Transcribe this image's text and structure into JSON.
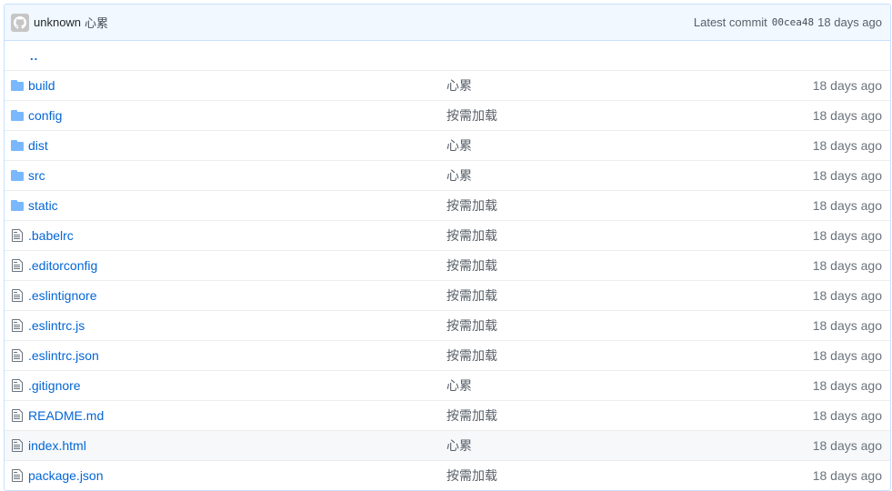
{
  "commit": {
    "author": "unknown",
    "message": "心累",
    "latest_label": "Latest commit",
    "sha": "00cea48",
    "age": "18 days ago"
  },
  "parent_dir": "..",
  "files": [
    {
      "type": "directory",
      "name": "build",
      "message": "心累",
      "age": "18 days ago"
    },
    {
      "type": "directory",
      "name": "config",
      "message": "按需加载",
      "age": "18 days ago"
    },
    {
      "type": "directory",
      "name": "dist",
      "message": "心累",
      "age": "18 days ago"
    },
    {
      "type": "directory",
      "name": "src",
      "message": "心累",
      "age": "18 days ago"
    },
    {
      "type": "directory",
      "name": "static",
      "message": "按需加载",
      "age": "18 days ago"
    },
    {
      "type": "file",
      "name": ".babelrc",
      "message": "按需加载",
      "age": "18 days ago"
    },
    {
      "type": "file",
      "name": ".editorconfig",
      "message": "按需加载",
      "age": "18 days ago"
    },
    {
      "type": "file",
      "name": ".eslintignore",
      "message": "按需加载",
      "age": "18 days ago"
    },
    {
      "type": "file",
      "name": ".eslintrc.js",
      "message": "按需加载",
      "age": "18 days ago"
    },
    {
      "type": "file",
      "name": ".eslintrc.json",
      "message": "按需加载",
      "age": "18 days ago"
    },
    {
      "type": "file",
      "name": ".gitignore",
      "message": "心累",
      "age": "18 days ago"
    },
    {
      "type": "file",
      "name": "README.md",
      "message": "按需加载",
      "age": "18 days ago"
    },
    {
      "type": "file",
      "name": "index.html",
      "message": "心累",
      "age": "18 days ago",
      "highlighted": true
    },
    {
      "type": "file",
      "name": "package.json",
      "message": "按需加载",
      "age": "18 days ago"
    }
  ],
  "icons": {
    "directory": "folder-icon",
    "file": "file-icon",
    "avatar": "github-avatar-icon"
  },
  "colors": {
    "link": "#0366d6",
    "folder": "#79b8ff",
    "header_bg": "#f1f8ff",
    "border": "#c8e1ff",
    "highlight_bg": "#f6f8fa"
  }
}
